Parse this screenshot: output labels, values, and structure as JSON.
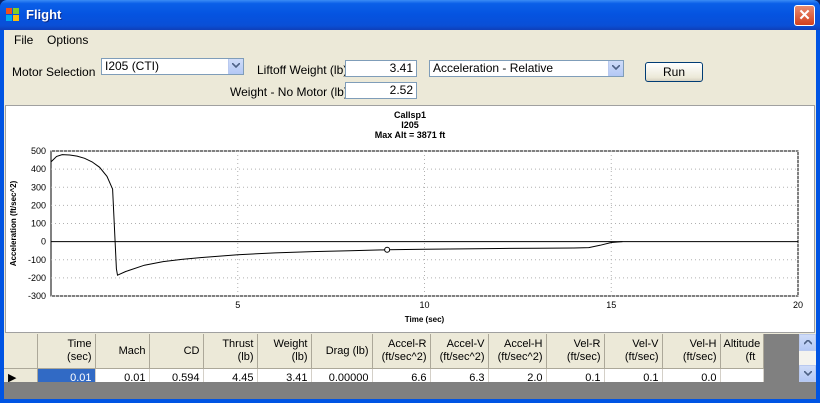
{
  "window": {
    "title": "Flight",
    "close_glyph": "✕"
  },
  "menu": {
    "items": [
      "File",
      "Options"
    ]
  },
  "controls": {
    "motor_label": "Motor Selection",
    "motor_value": "I205 (CTI)",
    "liftoff_label": "Liftoff Weight (lb)",
    "liftoff_value": "3.41",
    "nomotor_label": "Weight - No Motor (lb)",
    "nomotor_value": "2.52",
    "plot_select_value": "Acceleration - Relative",
    "run_label": "Run"
  },
  "chart_data": {
    "type": "line",
    "title": [
      "Callsp1",
      "I205",
      "Max Alt = 3871 ft"
    ],
    "xlabel": "Time (sec)",
    "ylabel": "Acceleration (ft/sec^2)",
    "xlim": [
      0,
      20
    ],
    "ylim": [
      -300,
      500
    ],
    "x_ticks": [
      5,
      10,
      15,
      20
    ],
    "y_ticks": [
      500,
      400,
      300,
      200,
      100,
      0,
      -100,
      -200,
      -300
    ],
    "grid": true,
    "x": [
      0,
      0.15,
      0.3,
      0.5,
      0.7,
      0.9,
      1.1,
      1.3,
      1.5,
      1.65,
      1.75,
      1.78,
      2.0,
      2.5,
      3,
      3.5,
      4,
      5,
      6,
      7,
      8,
      9,
      10,
      11,
      12,
      13,
      14,
      14.4,
      14.7,
      15.0,
      15.3
    ],
    "y": [
      440,
      470,
      480,
      478,
      472,
      460,
      440,
      410,
      360,
      290,
      -150,
      -185,
      -165,
      -130,
      -110,
      -98,
      -88,
      -72,
      -62,
      -55,
      -50,
      -45,
      -42,
      -40,
      -38,
      -36,
      -35,
      -33,
      -20,
      -5,
      0
    ],
    "marker": {
      "x": 9.0,
      "y": -45
    },
    "colors": {
      "line": "#000000",
      "grid": "#b0b0b0"
    }
  },
  "table": {
    "columns": [
      [
        "Time",
        "(sec)"
      ],
      [
        "Mach",
        ""
      ],
      [
        "CD",
        ""
      ],
      [
        "Thrust",
        "(lb)"
      ],
      [
        "Weight",
        "(lb)"
      ],
      [
        "Drag (lb)",
        ""
      ],
      [
        "Accel-R",
        "(ft/sec^2)"
      ],
      [
        "Accel-V",
        "(ft/sec^2)"
      ],
      [
        "Accel-H",
        "(ft/sec^2)"
      ],
      [
        "Vel-R",
        "(ft/sec)"
      ],
      [
        "Vel-V",
        "(ft/sec)"
      ],
      [
        "Vel-H",
        "(ft/sec)"
      ],
      [
        "Altitude",
        "(ft"
      ]
    ],
    "rows": [
      [
        "0.01",
        "0.01",
        "0.594",
        "4.45",
        "3.41",
        "0.00000",
        "6.6",
        "6.3",
        "2.0",
        "0.1",
        "0.1",
        "0.0",
        ""
      ]
    ],
    "row_marker": "▶"
  }
}
